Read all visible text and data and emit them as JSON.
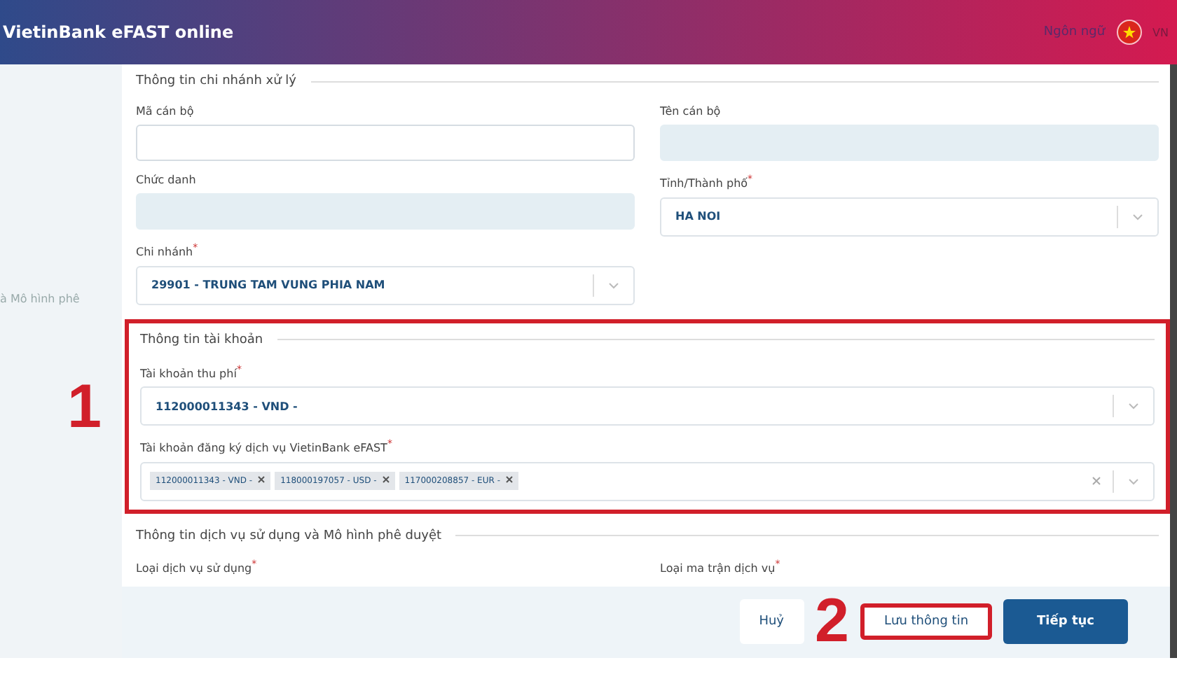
{
  "header": {
    "title": "VietinBank eFAST online",
    "language_label": "Ngôn ngữ",
    "language_code": "VN"
  },
  "sidebar": {
    "text": "à Mô hình phê"
  },
  "branch_section": {
    "title": "Thông tin chi nhánh xử lý",
    "left_fields": [
      {
        "kind": "input",
        "label": "Mã cán bộ",
        "disabled": false
      },
      {
        "kind": "input",
        "label": "Chức danh",
        "disabled": true
      },
      {
        "kind": "select",
        "label": "Chi nhánh$^{*}$",
        "value": "29901 - TRUNG TAM VUNG PHIA NAM"
      }
    ],
    "right_fields": [
      {
        "kind": "input",
        "label": "Tên cán bộ",
        "disabled": true
      },
      {
        "kind": "select",
        "label": "Tỉnh/Thành phố$^{*}$",
        "value": "HA NOI"
      }
    ]
  },
  "account_section": {
    "title": "Thông tin tài khoản",
    "highlighted": true,
    "annotation": "1",
    "fields": [
      {
        "kind": "select",
        "label": "Tài khoản thu phí$^{*}$",
        "value": "112000011343 - VND -"
      },
      {
        "kind": "multiselect",
        "label": "Tài khoản đăng ký dịch vụ VietinBank eFAST$^{*}$",
        "tags": [
          "112000011343 - VND -",
          "118000197057 - USD -",
          "117000208857 - EUR -"
        ]
      }
    ]
  },
  "service_section": {
    "title": "Thông tin dịch vụ sử dụng và Mô hình phê duyệt",
    "labels": [
      "Loại dịch vụ sử dụng$^{*}$",
      "Loại ma trận dịch vụ$^{*}$"
    ]
  },
  "buttons": [
    {
      "label": "Huỷ",
      "kind": "secondary",
      "highlighted": false
    },
    {
      "label": "Lưu thông tin",
      "kind": "secondary",
      "highlighted": true,
      "annotation": "2"
    },
    {
      "label": "Tiếp tục",
      "kind": "primary",
      "highlighted": false
    }
  ]
}
